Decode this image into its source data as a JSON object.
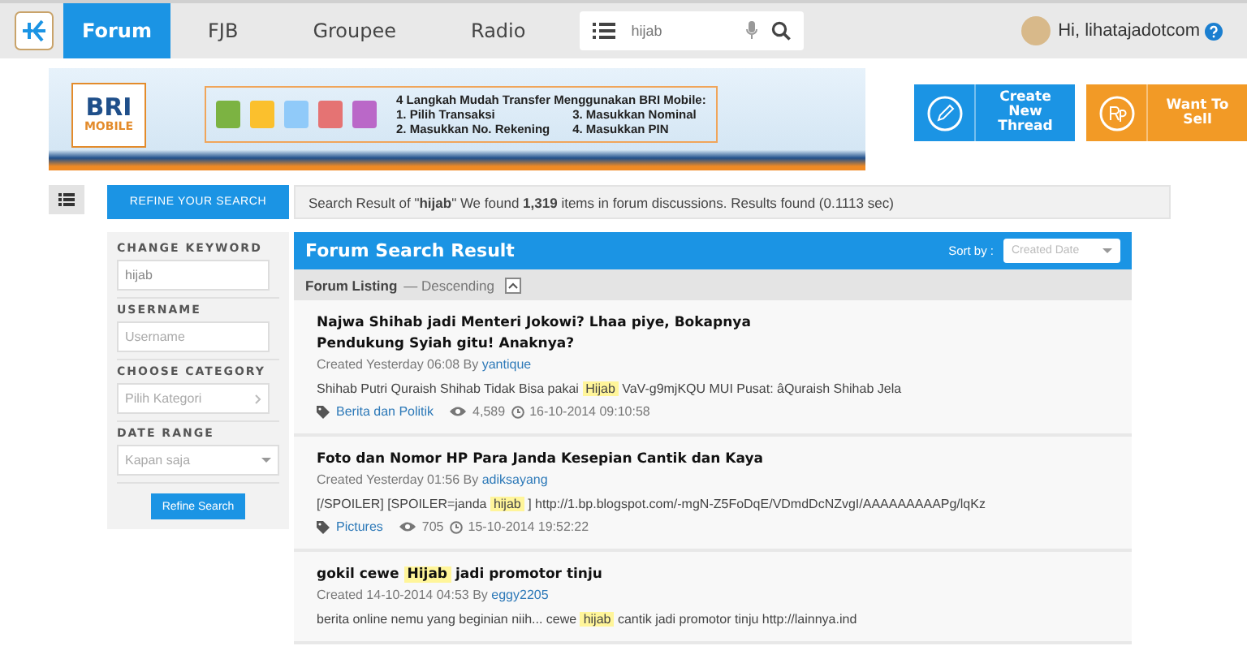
{
  "topbar": {
    "tabs": [
      {
        "label": "Forum",
        "selected": true
      },
      {
        "label": "FJB",
        "selected": false
      },
      {
        "label": "Groupee",
        "selected": false
      },
      {
        "label": "Radio",
        "selected": false
      }
    ],
    "search": {
      "value": "hijab"
    },
    "greeting": "Hi, lihatajadotcom"
  },
  "banner": {
    "brand": "BRI",
    "brand_sub": "MOBILE",
    "heading": "4 Langkah Mudah Transfer Menggunakan BRI Mobile:",
    "steps": [
      "1. Pilih Transaksi",
      "3. Masukkan Nominal",
      "2. Masukkan No. Rekening",
      "4. Masukkan PIN"
    ]
  },
  "actions": [
    {
      "label": "Create New Thread",
      "kind": "thread"
    },
    {
      "label": "Want To Sell",
      "kind": "sell"
    }
  ],
  "refine_tab": "REFINE YOUR SEARCH",
  "summary": "Search Result of \"**hijab**\" We found **1,319** items in forum discussions. Results found (0.1113 sec)",
  "sidebar": {
    "fields": [
      {
        "label": "CHANGE KEYWORD",
        "kind": "text",
        "value": "hijab"
      },
      {
        "label": "USERNAME",
        "kind": "text",
        "placeholder": "Username"
      },
      {
        "label": "CHOOSE CATEGORY",
        "kind": "select",
        "placeholder": "Pilih Kategori"
      },
      {
        "label": "DATE RANGE",
        "kind": "dropdown",
        "placeholder": "Kapan saja"
      }
    ],
    "button": "Refine Search"
  },
  "results": {
    "title": "Forum Search Result",
    "sort_label": "Sort by :",
    "sort_placeholder": "Created Date",
    "listing": "Forum Listing",
    "order": "— Descending",
    "posts": [
      {
        "title": [
          {
            "text": "Najwa Shihab jadi Menteri Jokowi? Lhaa piye, Bokapnya Pendukung Syiah gitu! Anaknya?",
            "highlight": false
          }
        ],
        "created": "Created Yesterday 06:08 By",
        "author": "yantique",
        "snippet": [
          {
            "text": "Shihab Putri Quraish Shihab Tidak Bisa pakai ",
            "highlight": false
          },
          {
            "text": "Hijab",
            "highlight": true
          },
          {
            "text": " VaV-g9mjKQU MUI Pusat: âQuraish Shihab Jela",
            "highlight": false
          }
        ],
        "category": "Berita dan Politik",
        "views": "4,589",
        "date": "16-10-2014 09:10:58"
      },
      {
        "title": [
          {
            "text": "Foto dan Nomor HP Para Janda Kesepian Cantik dan Kaya",
            "highlight": false
          }
        ],
        "created": "Created Yesterday 01:56 By",
        "author": "adiksayang",
        "snippet": [
          {
            "text": "[/SPOILER] [SPOILER=janda ",
            "highlight": false
          },
          {
            "text": "hijab",
            "highlight": true
          },
          {
            "text": " ] http://1.bp.blogspot.com/-mgN-Z5FoDqE/VDmdDcNZvgI/AAAAAAAAAPg/lqKz",
            "highlight": false
          }
        ],
        "category": "Pictures",
        "views": "705",
        "date": "15-10-2014 19:52:22"
      },
      {
        "title": [
          {
            "text": "gokil cewe ",
            "highlight": false
          },
          {
            "text": "Hijab",
            "highlight": true
          },
          {
            "text": " jadi promotor tinju",
            "highlight": false
          }
        ],
        "created": "Created 14-10-2014 04:53 By",
        "author": "eggy2205",
        "snippet": [
          {
            "text": "berita online nemu yang beginian niih... cewe ",
            "highlight": false
          },
          {
            "text": "hijab",
            "highlight": true
          },
          {
            "text": " cantik jadi promotor tinju http://lainnya.ind",
            "highlight": false
          }
        ]
      }
    ]
  }
}
